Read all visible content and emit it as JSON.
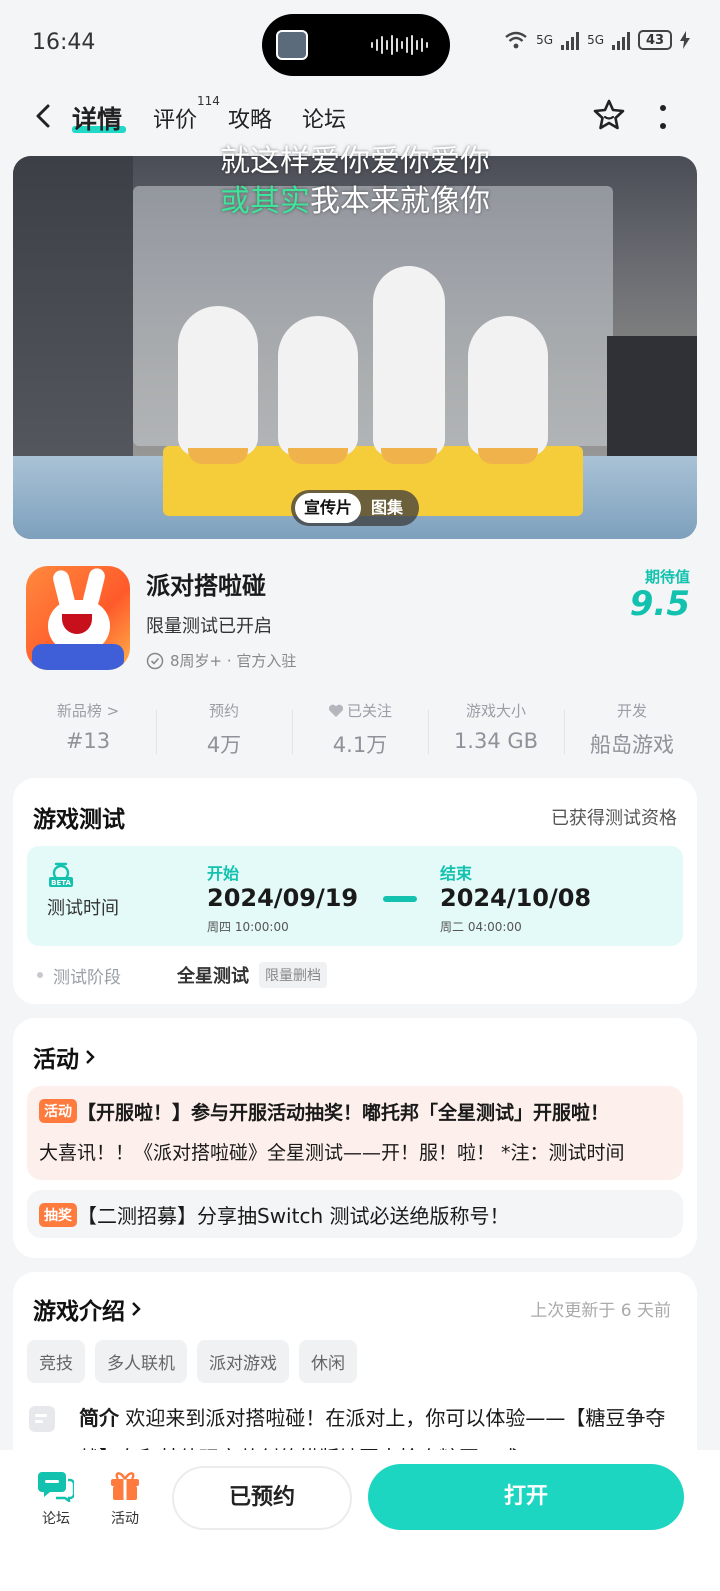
{
  "status_bar": {
    "time": "16:44",
    "battery": "43",
    "net1": "5G",
    "net2": "5G"
  },
  "nav": {
    "tabs": [
      "详情",
      "评价",
      "攻略",
      "论坛"
    ],
    "review_count": "114"
  },
  "media": {
    "subtitle_line1": "就这样爱你爱你爱你",
    "subtitle_line2_highlight": "或其实",
    "subtitle_line2_rest": "我本来就像你",
    "tabs": [
      "宣传片",
      "图集"
    ]
  },
  "app": {
    "name": "派对搭啦碰",
    "subtitle": "限量测试已开启",
    "meta": "8周岁+ · 官方入驻",
    "score_label": "期待值",
    "score": "9.5"
  },
  "stats": [
    {
      "key": "新品榜 >",
      "value": "#13"
    },
    {
      "key": "预约",
      "value": "4万"
    },
    {
      "key": "已关注",
      "value": "4.1万"
    },
    {
      "key": "游戏大小",
      "value": "1.34 GB"
    },
    {
      "key": "开发",
      "value": "船岛游戏"
    }
  ],
  "game_test": {
    "title": "游戏测试",
    "status": "已获得测试资格",
    "time_label": "测试时间",
    "start_tag": "开始",
    "start_date": "2024/09/19",
    "start_time": "周四  10:00:00",
    "end_tag": "结束",
    "end_date": "2024/10/08",
    "end_time": "周二  04:00:00",
    "stage_label": "测试阶段",
    "stage_value": "全星测试",
    "stage_tag": "限量删档"
  },
  "activities": {
    "title": "活动",
    "item1_badge": "活动",
    "item1_title": "【开服啦！】参与开服活动抽奖！嘟托邦「全星测试」开服啦！",
    "item1_body": "大喜讯！！《派对搭啦碰》全星测试——开！服！啦！ *注：测试时间",
    "item2_badge": "抽奖",
    "item2_title": "【二测招募】分享抽Switch 测试必送绝版称号！"
  },
  "intro": {
    "title": "游戏介绍",
    "updated": "上次更新于 6 天前",
    "tags": [
      "竞技",
      "多人联机",
      "派对游戏",
      "休闲"
    ],
    "label": "简介",
    "text": "欢迎来到派对搭啦碰！在派对上，你可以体验——【糖豆争夺战】在和其他玩家共创的横版地图中抢夺糖豆，成"
  },
  "bottom": {
    "forum": "论坛",
    "activity": "活动",
    "reserved": "已预约",
    "open": "打开"
  },
  "colors": {
    "accent": "#1dd6c1",
    "accent_text": "#12c2ae",
    "activity_badge": "#ff7a3d"
  }
}
